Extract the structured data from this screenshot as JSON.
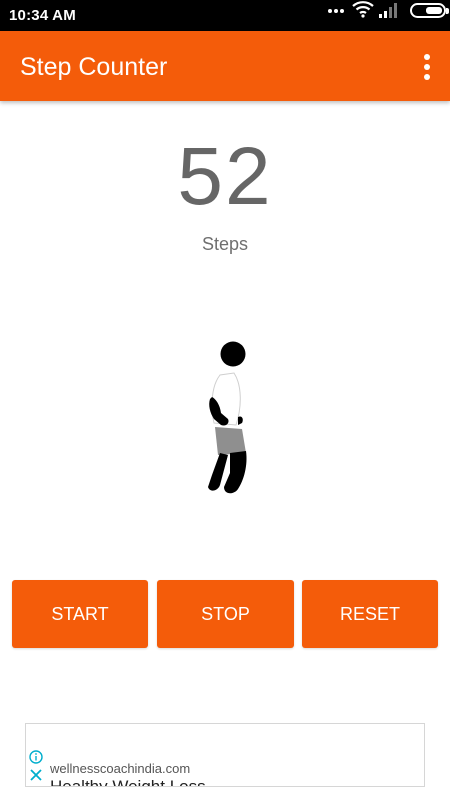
{
  "status_bar": {
    "time": "10:34 AM",
    "icons": [
      "more-dots-icon",
      "wifi-icon",
      "signal-icon",
      "battery-icon"
    ]
  },
  "app_bar": {
    "title": "Step Counter",
    "menu_icon": "overflow-menu-icon",
    "color": "#f45c0a"
  },
  "counter": {
    "value": "52",
    "label": "Steps"
  },
  "figure": {
    "icon": "walking-person-icon"
  },
  "buttons": {
    "start": "START",
    "stop": "STOP",
    "reset": "RESET",
    "color": "#f45c0a"
  },
  "ad": {
    "domain": "wellnesscoachindia.com",
    "headline": "Healthy Weight Loss",
    "info_icon": "info-icon",
    "close_icon": "close-icon",
    "icon_color": "#00aecd"
  }
}
